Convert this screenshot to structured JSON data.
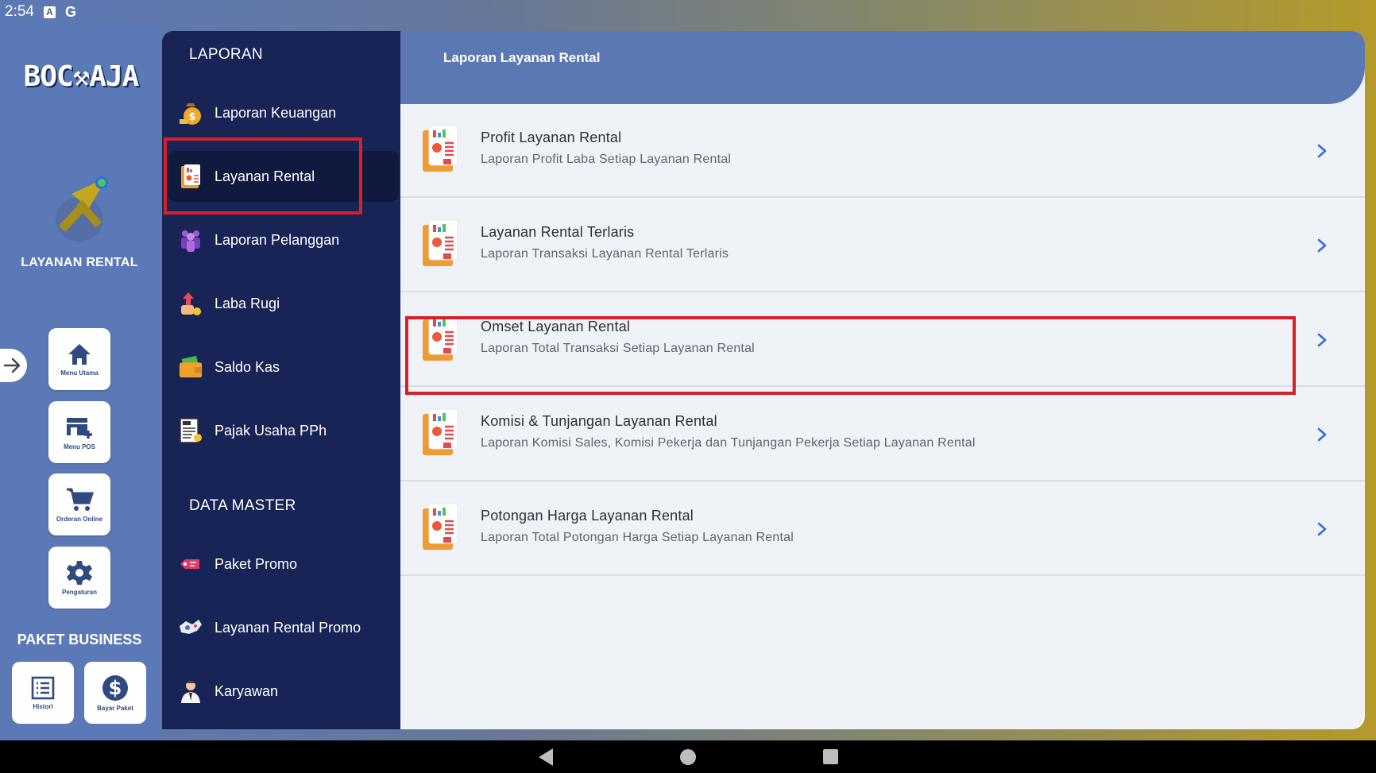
{
  "status_bar": {
    "time": "2:54",
    "icon_a": "A",
    "icon_g": "G"
  },
  "left_rail": {
    "logo_text": "BOC⚒AJA",
    "module_title": "LAYANAN RENTAL",
    "buttons": [
      {
        "label": "Menu Utama",
        "icon": "home-icon"
      },
      {
        "label": "Menu POS",
        "icon": "pos-icon"
      },
      {
        "label": "Orderan Online",
        "icon": "cart-icon"
      },
      {
        "label": "Pengaturan",
        "icon": "gear-icon"
      }
    ],
    "paket_title": "PAKET BUSINESS",
    "paket_buttons": [
      {
        "label": "Histori",
        "icon": "list-icon"
      },
      {
        "label": "Bayar Paket",
        "icon": "dollar-icon"
      }
    ]
  },
  "sidebar": {
    "section_laporan": "LAPORAN",
    "laporan_items": [
      {
        "label": "Laporan Keuangan",
        "icon": "money-bag-icon"
      },
      {
        "label": "Layanan Rental",
        "icon": "report-icon",
        "active": true
      },
      {
        "label": "Laporan Pelanggan",
        "icon": "customers-icon"
      },
      {
        "label": "Laba Rugi",
        "icon": "profit-icon"
      },
      {
        "label": "Saldo Kas",
        "icon": "wallet-icon"
      },
      {
        "label": "Pajak Usaha PPh",
        "icon": "tax-icon"
      }
    ],
    "section_master": "DATA MASTER",
    "master_items": [
      {
        "label": "Paket Promo",
        "icon": "promo-tag-icon"
      },
      {
        "label": "Layanan Rental Promo",
        "icon": "promo-icon"
      },
      {
        "label": "Karyawan",
        "icon": "employee-icon"
      }
    ]
  },
  "main": {
    "header_title": "Laporan Layanan Rental",
    "rows": [
      {
        "title": "Profit Layanan Rental",
        "subtitle": "Laporan Profit Laba Setiap Layanan Rental"
      },
      {
        "title": "Layanan Rental Terlaris",
        "subtitle": "Laporan Transaksi Layanan Rental Terlaris"
      },
      {
        "title": "Omset Layanan Rental",
        "subtitle": "Laporan Total Transaksi Setiap Layanan Rental"
      },
      {
        "title": "Komisi & Tunjangan Layanan Rental",
        "subtitle": "Laporan Komisi Sales, Komisi Pekerja dan Tunjangan Pekerja Setiap Layanan Rental"
      },
      {
        "title": "Potongan Harga Layanan Rental",
        "subtitle": "Laporan Total Potongan Harga Setiap Layanan Rental"
      }
    ]
  },
  "colors": {
    "rail": "#5b79b6",
    "sidebar": "#172455",
    "header": "#5c78b3",
    "highlight": "#d8202a",
    "chevron": "#2f6fe0"
  }
}
